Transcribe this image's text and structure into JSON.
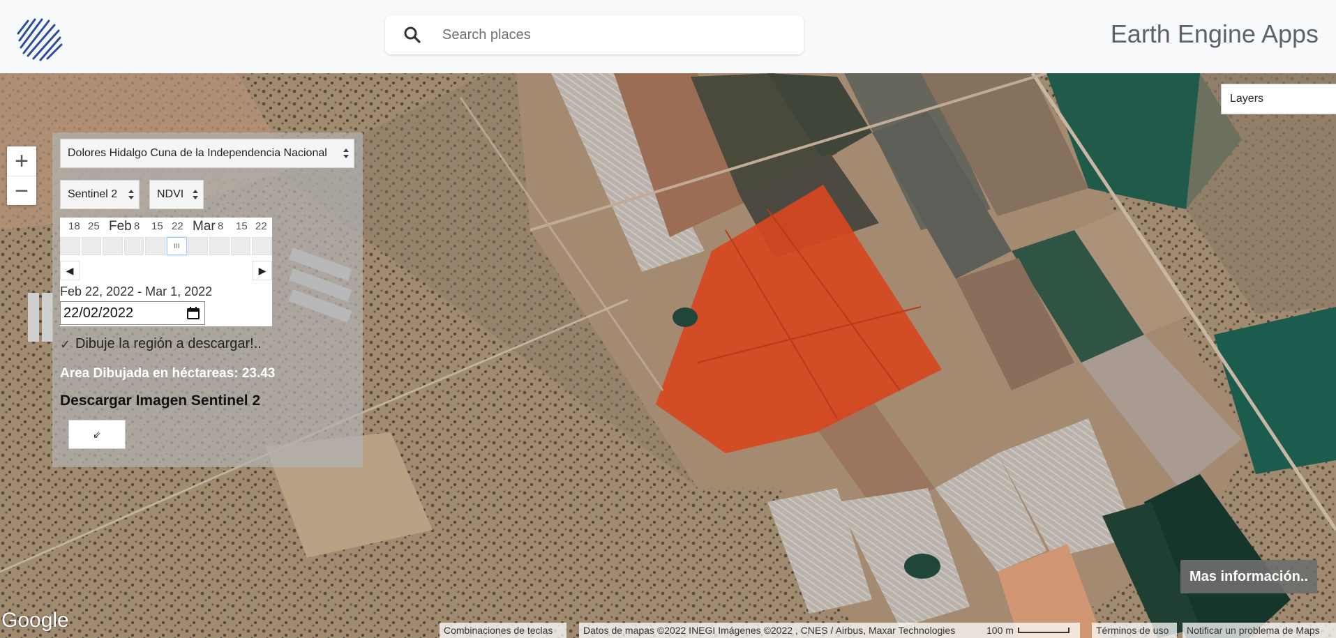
{
  "header": {
    "search_placeholder": "Search places",
    "brand": "Earth Engine Apps"
  },
  "map": {
    "zoom_in": "+",
    "zoom_out": "−",
    "layers_label": "Layers",
    "more_info": "Mas información..",
    "google_logo": "Google",
    "attribution": {
      "shortcuts": "Combinaciones de teclas",
      "data": "Datos de mapas ©2022 INEGI Imágenes ©2022 , CNES / Airbus, Maxar Technologies",
      "scale": "100 m",
      "terms": "Términos de uso",
      "report": "Notificar un problema de Maps"
    }
  },
  "panel": {
    "region_select": "Dolores Hidalgo Cuna de la Independencia Nacional",
    "satellite_select": "Sentinel 2",
    "index_select": "NDVI",
    "timeline": {
      "ticks": [
        "18",
        "25",
        "Feb",
        "8",
        "15",
        "22",
        "Mar",
        "8",
        "15",
        "22"
      ],
      "active_cell_label": "III",
      "prev": "◀",
      "next": "▶",
      "range_label": "Feb 22, 2022 - Mar 1, 2022",
      "date_value": "22/02/2022"
    },
    "checkbox_label": "Dibuje la región a descargar!..",
    "area_text": "Area Dibujada en héctareas: 23.43",
    "download_title": "Descargar Imagen Sentinel 2",
    "download_button": "⇙"
  }
}
